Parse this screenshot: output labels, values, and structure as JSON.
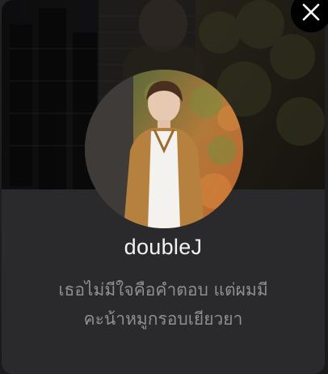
{
  "profile": {
    "name": "doubleJ",
    "bio_line1": "เธอไม่มีใจคือคำตอบ แต่ผมมี",
    "bio_line2": "คะน้าหมูกรอบเยียวยา"
  },
  "controls": {
    "close_icon": "close-icon"
  },
  "colors": {
    "card_background": "#2a2a2c",
    "name_text": "#f2f2f2",
    "bio_text": "#8e8e93",
    "close_button": "#000000"
  }
}
